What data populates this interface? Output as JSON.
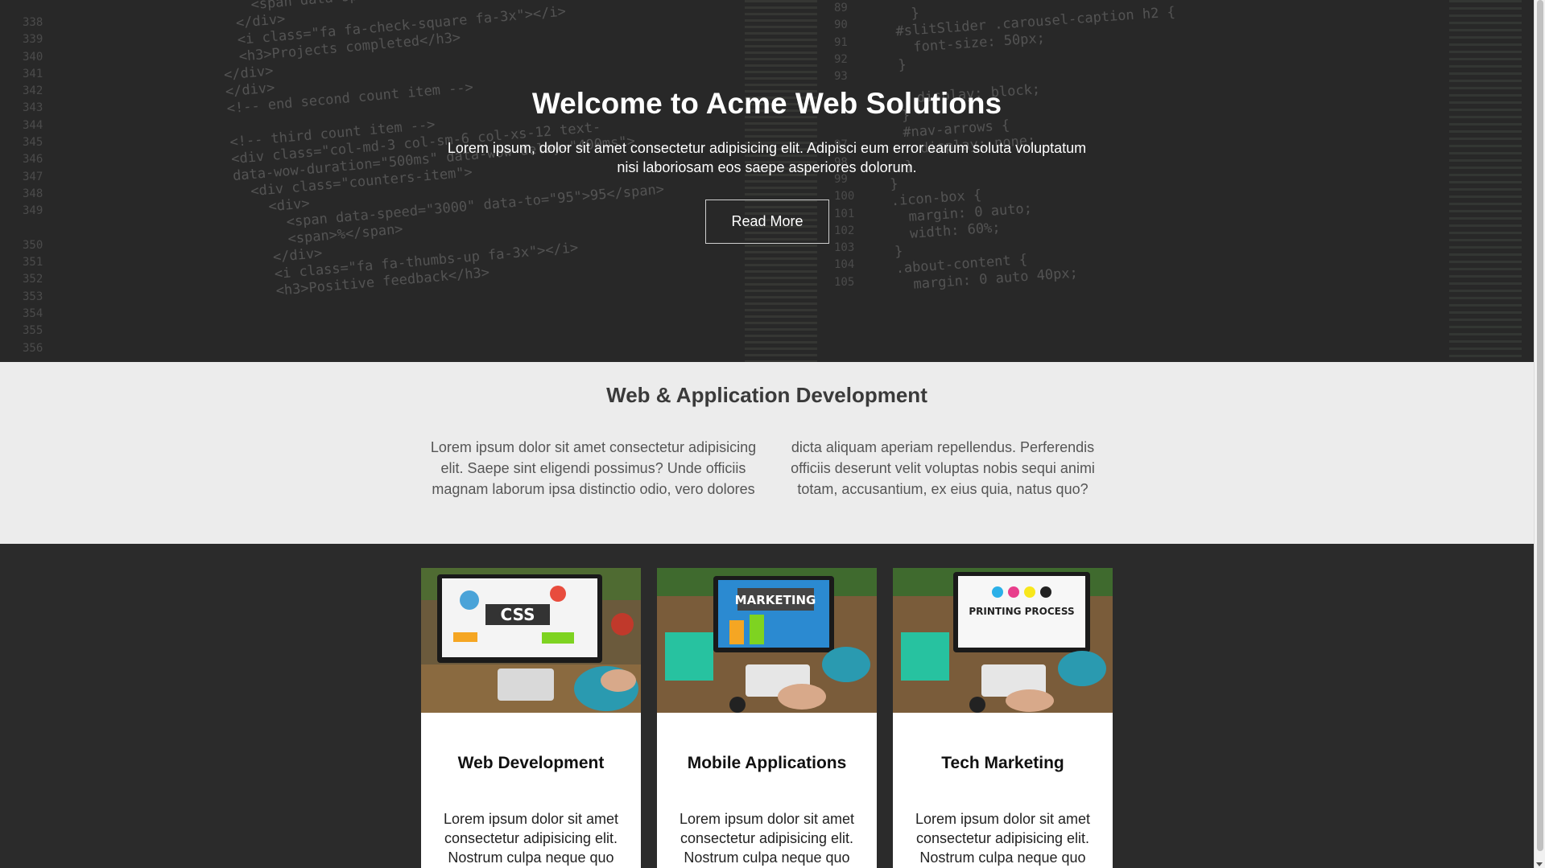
{
  "hero": {
    "title": "Welcome to Acme Web Solutions",
    "text": "Lorem ipsum, dolor sit amet consectetur adipisicing elit. Adipisci eum error earum soluta voluptatum nisi laboriosam eos saepe asperiores dolorum.",
    "button_label": "Read More",
    "code_left_lines": [
      "338",
      "339",
      "340",
      "341",
      "342",
      "343",
      "344",
      "345",
      "346",
      "347",
      "348",
      "349",
      "",
      "350",
      "351",
      "352",
      "353",
      "354",
      "355",
      "356"
    ],
    "code_right_lines": [
      "89",
      "90",
      "91",
      "92",
      "93",
      "",
      "",
      "",
      "97",
      "98",
      "99",
      "100",
      "101",
      "102",
      "103",
      "104",
      "105"
    ]
  },
  "development": {
    "title": "Web & Application Development",
    "col_left": "Lorem ipsum dolor sit amet consectetur adipisicing elit. Saepe sint eligendi possimus? Unde officiis magnam laborum ipsa distinctio odio, vero dolores",
    "col_right": "dicta aliquam aperiam repellendus. Perferendis officiis deserunt velit voluptas nobis sequi animi totam, accusantium, ex eius quia, natus quo?"
  },
  "cards": [
    {
      "title": "Web Development",
      "text": "Lorem ipsum dolor sit amet consectetur adipisicing elit. Nostrum culpa neque quo",
      "image_label": "CSS"
    },
    {
      "title": "Mobile Applications",
      "text": "Lorem ipsum dolor sit amet consectetur adipisicing elit. Nostrum culpa neque quo",
      "image_label": "MARKETING"
    },
    {
      "title": "Tech Marketing",
      "text": "Lorem ipsum dolor sit amet consectetur adipisicing elit. Nostrum culpa neque quo",
      "image_label": "PRINTING PROCESS"
    }
  ],
  "colors": {
    "hero_bg": "#2e2e2e",
    "section_light": "#ececec",
    "section_dark": "#2b2b2b",
    "card_bg": "#ffffff"
  }
}
